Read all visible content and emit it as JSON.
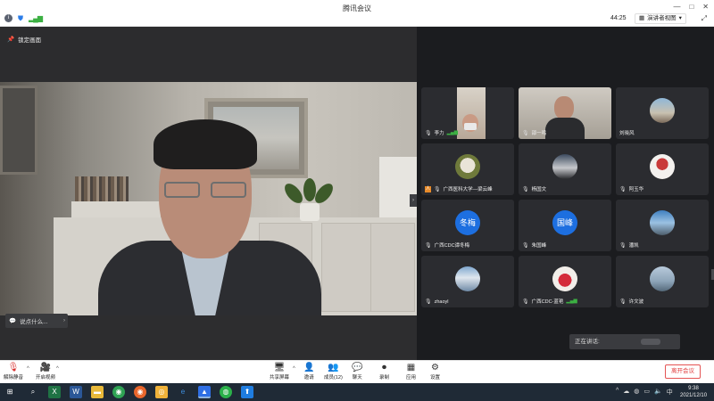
{
  "window": {
    "title": "腾讯会议",
    "timer": "44:25",
    "view_label": "演讲者视图",
    "controls": [
      "—",
      "□",
      "✕"
    ]
  },
  "main": {
    "pin_label": "锁定画面",
    "chat_placeholder": "说点什么..."
  },
  "gallery": {
    "tiles": [
      {
        "name": "李力",
        "type": "camera"
      },
      {
        "name": "邵一鸣",
        "type": "camera"
      },
      {
        "name": "刘晓风",
        "type": "photo"
      },
      {
        "name": "广西医科大学—梁云峰",
        "type": "photo"
      },
      {
        "name": "杨国文",
        "type": "photo"
      },
      {
        "name": "阿玉华",
        "type": "photo"
      },
      {
        "name": "广西CDC谭冬梅",
        "type": "text",
        "avatar_text": "冬梅"
      },
      {
        "name": "朱国峰",
        "type": "text",
        "avatar_text": "国峰"
      },
      {
        "name": "潘凯",
        "type": "photo"
      },
      {
        "name": "zhaoyl",
        "type": "photo"
      },
      {
        "name": "广西CDC-蓝艳",
        "type": "photo"
      },
      {
        "name": "许文波",
        "type": "photo"
      }
    ],
    "speaking_label": "正在讲话:"
  },
  "toolbar": {
    "mute": "解除静音",
    "video": "开启视频",
    "share": "共享屏幕",
    "invite": "邀请",
    "members": "成员(12)",
    "chat": "聊天",
    "record": "录制",
    "apps": "应用",
    "settings": "设置",
    "leave": "离开会议"
  },
  "taskbar": {
    "time": "9:38",
    "date": "2021/12/10",
    "ime": "中"
  },
  "colors": {
    "accent_blue": "#1d6fe0",
    "leave_red": "#e03b3b",
    "muted_red": "#d9312f"
  }
}
